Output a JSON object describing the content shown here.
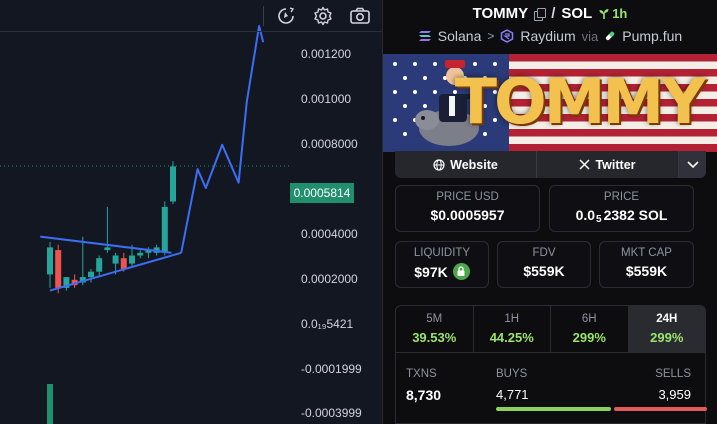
{
  "chart": {
    "price_labels": [
      "0.001200",
      "0.001000",
      "0.0008000",
      "0.0005814",
      "0.0004000",
      "0.0002000",
      "0.0₁₉5421",
      "-0.0001999",
      "-0.0003999"
    ],
    "current_price_tag": "0.0005814"
  },
  "chart_data": {
    "type": "candlestick",
    "y_axis_ticks": [
      0.0012,
      0.001,
      0.0008,
      0.0004,
      0.0002,
      0.0,
      -0.0001999,
      -0.0003999
    ],
    "current_price": 0.0005814,
    "candles": [
      {
        "open": 0.00028,
        "high": 0.0003,
        "low": 0.00013,
        "close": 0.00018,
        "color": "green"
      },
      {
        "open": 0.00027,
        "high": 0.00029,
        "low": 0.00011,
        "close": 0.00013,
        "color": "red"
      },
      {
        "open": 0.00013,
        "high": 0.00015,
        "low": 0.00012,
        "close": 0.00017,
        "color": "green"
      },
      {
        "open": 0.00016,
        "high": 0.00018,
        "low": 0.00013,
        "close": 0.00014,
        "color": "red"
      },
      {
        "open": 0.00015,
        "high": 0.00032,
        "low": 0.00014,
        "close": 0.00017,
        "color": "green"
      },
      {
        "open": 0.00017,
        "high": 0.0002,
        "low": 0.00015,
        "close": 0.00019,
        "color": "green"
      },
      {
        "open": 0.00019,
        "high": 0.00025,
        "low": 0.00017,
        "close": 0.00024,
        "color": "green"
      },
      {
        "open": 0.00028,
        "high": 0.00043,
        "low": 0.00026,
        "close": 0.00027,
        "color": "green"
      },
      {
        "open": 0.00025,
        "high": 0.00026,
        "low": 0.00018,
        "close": 0.00022,
        "color": "green"
      },
      {
        "open": 0.00024,
        "high": 0.00026,
        "low": 0.00019,
        "close": 0.0002,
        "color": "red"
      },
      {
        "open": 0.00022,
        "high": 0.00029,
        "low": 0.00021,
        "close": 0.00025,
        "color": "green"
      },
      {
        "open": 0.00025,
        "high": 0.00027,
        "low": 0.00024,
        "close": 0.00026,
        "color": "green"
      },
      {
        "open": 0.00026,
        "high": 0.00028,
        "low": 0.00024,
        "close": 0.00027,
        "color": "green"
      },
      {
        "open": 0.00026,
        "high": 0.00029,
        "low": 0.00025,
        "close": 0.00028,
        "color": "green"
      },
      {
        "open": 0.00026,
        "high": 0.00045,
        "low": 0.00025,
        "close": 0.00043,
        "color": "green"
      },
      {
        "open": 0.00045,
        "high": 0.0006,
        "low": 0.00044,
        "close": 0.00058,
        "color": "green"
      }
    ],
    "volume_bar": {
      "color": "green"
    },
    "drawings": {
      "triangle_upper": [
        [
          0,
          0.00032
        ],
        [
          16,
          0.00026
        ]
      ],
      "triangle_lower": [
        [
          0,
          0.00012
        ],
        [
          16,
          0.00026
        ]
      ],
      "projection": [
        [
          16,
          0.00026
        ],
        [
          18,
          0.00057
        ],
        [
          19,
          0.0005
        ],
        [
          21,
          0.00066
        ],
        [
          23,
          0.00052
        ],
        [
          24,
          0.00082
        ],
        [
          25.5,
          0.0011
        ],
        [
          26,
          0.00104
        ]
      ]
    },
    "colors": {
      "up": "#26a69a",
      "down": "#ef5350",
      "drawing": "#3b6ef6"
    }
  },
  "header": {
    "token": "TOMMY",
    "slash": "/",
    "quote": "SOL",
    "age": "1h",
    "chain": "Solana",
    "separator": ">",
    "dex": "Raydium",
    "via": "via",
    "launchpad": "Pump.fun"
  },
  "banner": {
    "title": "TOMMY"
  },
  "links": {
    "website": "Website",
    "twitter": "Twitter"
  },
  "stats": {
    "price_usd_label": "PRICE USD",
    "price_usd_value": "$0.0005957",
    "price_label": "PRICE",
    "price_prefix": "0.0",
    "price_zeros": "5",
    "price_rest": "2382 SOL",
    "liquidity_label": "LIQUIDITY",
    "liquidity_value": "$97K",
    "fdv_label": "FDV",
    "fdv_value": "$559K",
    "mktcap_label": "MKT CAP",
    "mktcap_value": "$559K"
  },
  "timeframes": [
    {
      "label": "5M",
      "change": "39.53%"
    },
    {
      "label": "1H",
      "change": "44.25%"
    },
    {
      "label": "6H",
      "change": "299%"
    },
    {
      "label": "24H",
      "change": "299%"
    }
  ],
  "txns": {
    "txns_label": "TXNS",
    "txns_value": "8,730",
    "buys_label": "BUYS",
    "buys_value": "4,771",
    "sells_label": "SELLS",
    "sells_value": "3,959",
    "buy_share": 0.5465
  },
  "colors": {
    "positive": "#9be46b",
    "buy_bar": "#8bd25a",
    "sell_bar": "#e15b5b",
    "accent": "#1f8f6c"
  }
}
